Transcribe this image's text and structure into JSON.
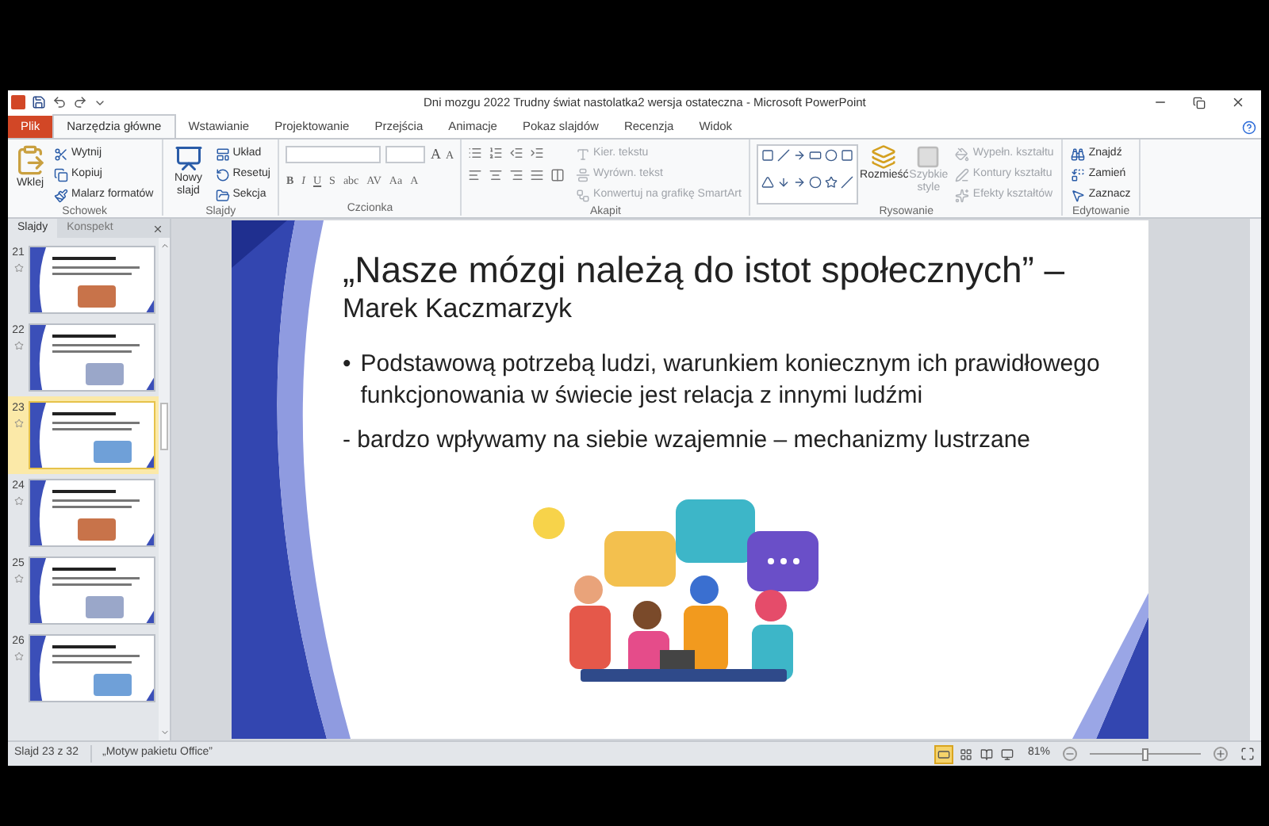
{
  "window": {
    "title": "Dni mozgu 2022 Trudny świat nastolatka2 wersja ostateczna - Microsoft PowerPoint"
  },
  "tabs": [
    {
      "label": "Plik",
      "kind": "file",
      "selected": false
    },
    {
      "label": "Narzędzia główne",
      "kind": "tab",
      "selected": true
    },
    {
      "label": "Wstawianie",
      "kind": "tab",
      "selected": false
    },
    {
      "label": "Projektowanie",
      "kind": "tab",
      "selected": false
    },
    {
      "label": "Przejścia",
      "kind": "tab",
      "selected": false
    },
    {
      "label": "Animacje",
      "kind": "tab",
      "selected": false
    },
    {
      "label": "Pokaz slajdów",
      "kind": "tab",
      "selected": false
    },
    {
      "label": "Recenzja",
      "kind": "tab",
      "selected": false
    },
    {
      "label": "Widok",
      "kind": "tab",
      "selected": false
    }
  ],
  "ribbon": [
    {
      "kind": "clipboard",
      "label": "Schowek",
      "large": [
        "Wklej"
      ],
      "items": [
        {
          "label": "Wytnij",
          "disabled": false
        },
        {
          "label": "Kopiuj",
          "disabled": false
        },
        {
          "label": "Malarz formatów",
          "disabled": false
        }
      ]
    },
    {
      "kind": "slides",
      "label": "Slajdy",
      "large": [
        "Nowy slajd"
      ],
      "items": [
        {
          "label": "Układ",
          "disabled": false
        },
        {
          "label": "Resetuj",
          "disabled": false
        },
        {
          "label": "Sekcja",
          "disabled": false
        }
      ]
    },
    {
      "kind": "font",
      "label": "Czcionka",
      "grow_shrink": [
        "A",
        "A"
      ],
      "buttons": [
        "B",
        "I",
        "U",
        "S",
        "abc",
        "AV",
        "Aa",
        "A"
      ]
    },
    {
      "kind": "paragraph",
      "label": "Akapit",
      "items": [
        {
          "label": "Kier. tekstu",
          "disabled": true
        },
        {
          "label": "Wyrówn. tekst",
          "disabled": true
        },
        {
          "label": "Konwertuj na grafikę SmartArt",
          "disabled": true
        }
      ]
    },
    {
      "kind": "drawing",
      "label": "Rysowanie",
      "large": [
        "Rozmieść",
        "Szybkie style"
      ],
      "large_disabled": [
        false,
        true
      ],
      "items": [
        {
          "label": "Wypełn. kształtu",
          "disabled": true
        },
        {
          "label": "Kontury kształtu",
          "disabled": true
        },
        {
          "label": "Efekty kształtów",
          "disabled": true
        }
      ]
    },
    {
      "kind": "editing",
      "label": "Edytowanie",
      "items": [
        {
          "label": "Znajdź",
          "disabled": false
        },
        {
          "label": "Zamień",
          "disabled": false
        },
        {
          "label": "Zaznacz",
          "disabled": false
        }
      ]
    }
  ],
  "panel": {
    "tabs": [
      {
        "label": "Slajdy",
        "selected": true
      },
      {
        "label": "Konspekt",
        "selected": false
      }
    ],
    "slides": [
      {
        "number": "21",
        "selected": false
      },
      {
        "number": "22",
        "selected": false
      },
      {
        "number": "23",
        "selected": true
      },
      {
        "number": "24",
        "selected": false
      },
      {
        "number": "25",
        "selected": false
      },
      {
        "number": "26",
        "selected": false
      }
    ]
  },
  "slide": {
    "title": "„Nasze mózgi należą do istot społecznych” –",
    "author": "Marek Kaczmarzyk",
    "bullets": [
      {
        "kind": "bullet",
        "marker": "•",
        "text": "Podstawową potrzebą ludzi, warunkiem koniecznym ich prawidłowego funkcjonowania w świecie jest relacja z innymi ludźmi"
      },
      {
        "kind": "plain",
        "text": "- bardzo wpływamy na siebie wzajemnie – mechanizmy lustrzane"
      }
    ]
  },
  "status_bar": {
    "slide": "Slajd 23 z 32",
    "theme": "„Motyw pakietu Office”",
    "views": [
      {
        "selected": true
      },
      {
        "selected": false
      },
      {
        "selected": false
      },
      {
        "selected": false
      }
    ],
    "zoom": "81%",
    "level": 0.5
  }
}
